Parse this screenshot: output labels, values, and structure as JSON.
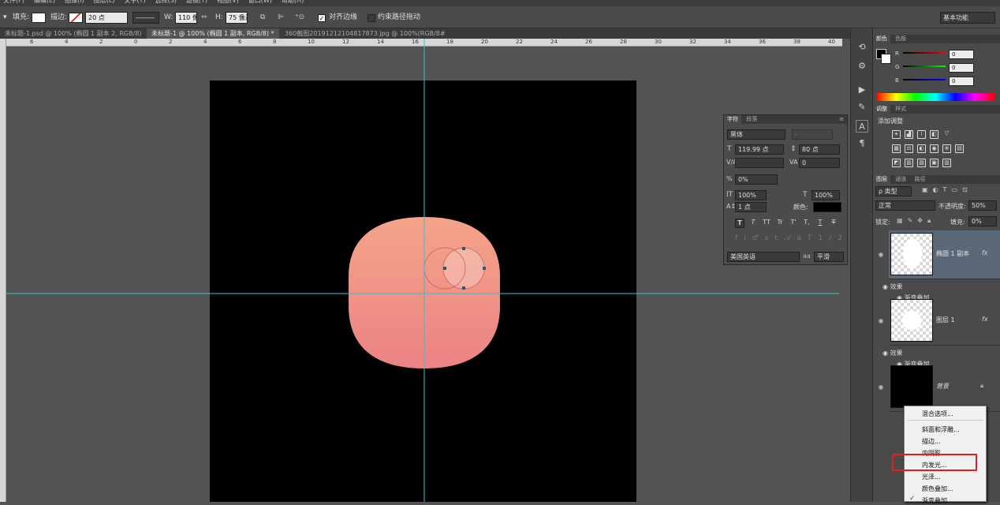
{
  "menu": [
    "文件(F)",
    "编辑(E)",
    "图像(I)",
    "图层(L)",
    "文字(Y)",
    "选择(S)",
    "滤镜(T)",
    "视图(V)",
    "窗口(W)",
    "帮助(H)"
  ],
  "options": {
    "fill_label": "填充:",
    "stroke_label": "描边:",
    "stroke_size": "20 点",
    "w_label": "W:",
    "w_value": "110 像",
    "h_label": "H:",
    "h_value": "75 像素",
    "align_edges": "对齐边缘",
    "constrain_path": "约束路径拖动",
    "workspace": "基本功能"
  },
  "tabs": [
    {
      "label": "未标题-1.psd @ 100% (椭圆 1 副本 2, RGB/8)",
      "close": "×"
    },
    {
      "label": "未标题-1 @ 100% (椭圆 1 副本, RGB/8) *",
      "close": "×"
    },
    {
      "label": "360截图20191212104817873.jpg @ 100%(RGB/8#)",
      "close": "×"
    }
  ],
  "ruler_h": [
    "6",
    "4",
    "2",
    "0",
    "2",
    "4",
    "6",
    "8",
    "10",
    "12",
    "14",
    "16",
    "18",
    "20",
    "22",
    "24",
    "26",
    "28",
    "30",
    "32",
    "34",
    "36",
    "38",
    "40"
  ],
  "color_panel": {
    "tabs": [
      "颜色",
      "色板"
    ],
    "r_label": "R",
    "r_value": "0",
    "g_label": "G",
    "g_value": "0",
    "b_label": "B",
    "b_value": "0"
  },
  "adjust_panel": {
    "tabs": [
      "调整",
      "样式"
    ],
    "title": "添加调整"
  },
  "layers_panel": {
    "tabs": [
      "图层",
      "通道",
      "路径"
    ],
    "filter_kind": "ρ 类型",
    "blend_mode": "正常",
    "opacity_label": "不透明度:",
    "opacity_value": "50%",
    "lock_label": "锁定:",
    "fill_label": "填充:",
    "fill_value": "0%",
    "layers": [
      {
        "name": "椭圆 1 副本",
        "fx": "fx",
        "effects_label": "效果",
        "effect": "渐变叠加"
      },
      {
        "name": "图层 1",
        "fx": "fx",
        "effects_label": "效果",
        "effect": "渐变叠加"
      },
      {
        "name": "背景"
      }
    ]
  },
  "char_panel": {
    "tabs": [
      "字符",
      "段落"
    ],
    "font": "黑体",
    "font_style": "-",
    "size": "119.99 点",
    "leading": "80 点",
    "kerning": "",
    "tracking": "0",
    "scale_pct": "0%",
    "vscale": "100%",
    "hscale": "100%",
    "baseline": "1 点",
    "color_label": "颜色:",
    "language": "美国英语",
    "aa_label": "aa",
    "aa_value": "平滑",
    "styles": [
      "T",
      "T",
      "TT",
      "Tr",
      "T'",
      "T,",
      "T",
      "T"
    ]
  },
  "context_menu": {
    "items": [
      "混合选项...",
      "斜面和浮雕...",
      "描边...",
      "内阴影...",
      "内发光...",
      "光泽...",
      "颜色叠加...",
      "渐变叠加..."
    ],
    "checked": "✓",
    "highlight_color": "#e02020"
  },
  "colors": {
    "shape_top": "#f4a48a",
    "shape_bottom": "#ec8284",
    "guide": "#33c4c8",
    "canvas": "#000000"
  }
}
